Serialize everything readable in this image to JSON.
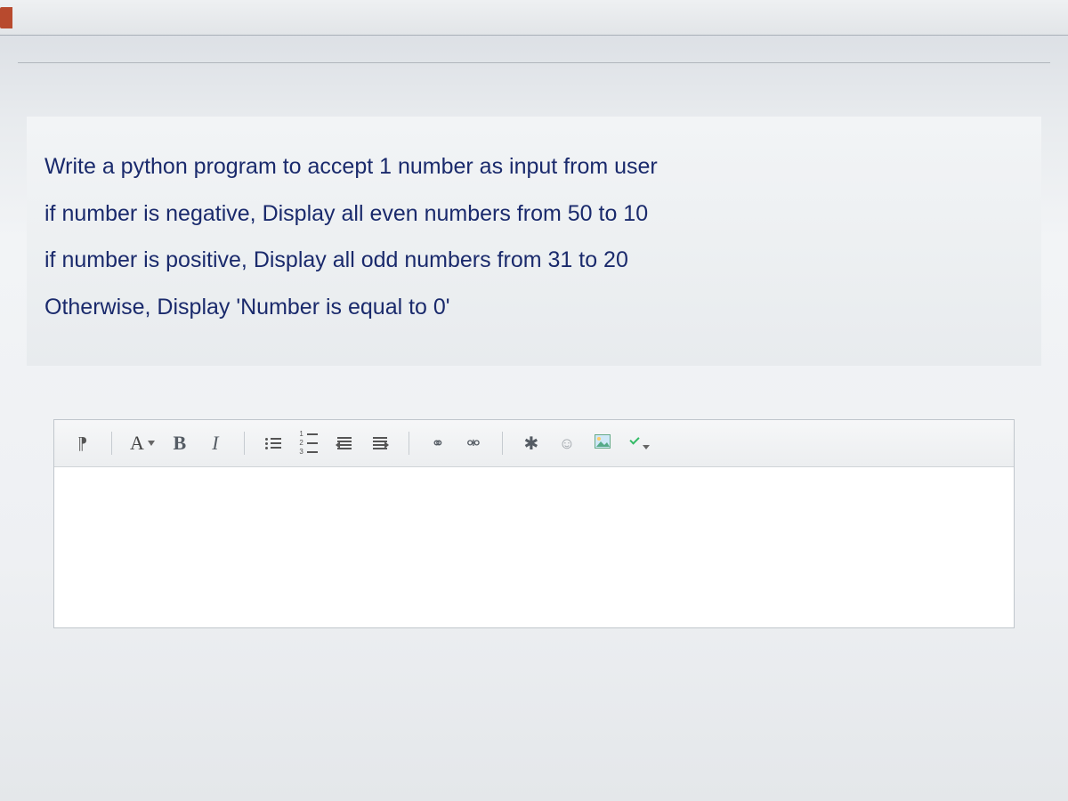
{
  "question": {
    "lines": [
      "Write a python program to accept 1 number as input from user",
      "if number is negative, Display all even numbers from 50 to 10",
      "if number is positive, Display all odd numbers from 31 to 20",
      "Otherwise, Display 'Number is equal to 0'"
    ]
  },
  "toolbar": {
    "paragraph_symbol": "¶",
    "font_label": "A",
    "bold_label": "B",
    "italic_label": "I",
    "link_symbol": "⚭",
    "unlink_symbol": "⚮",
    "mashup_symbol": "✱",
    "smile_symbol": "☺"
  }
}
